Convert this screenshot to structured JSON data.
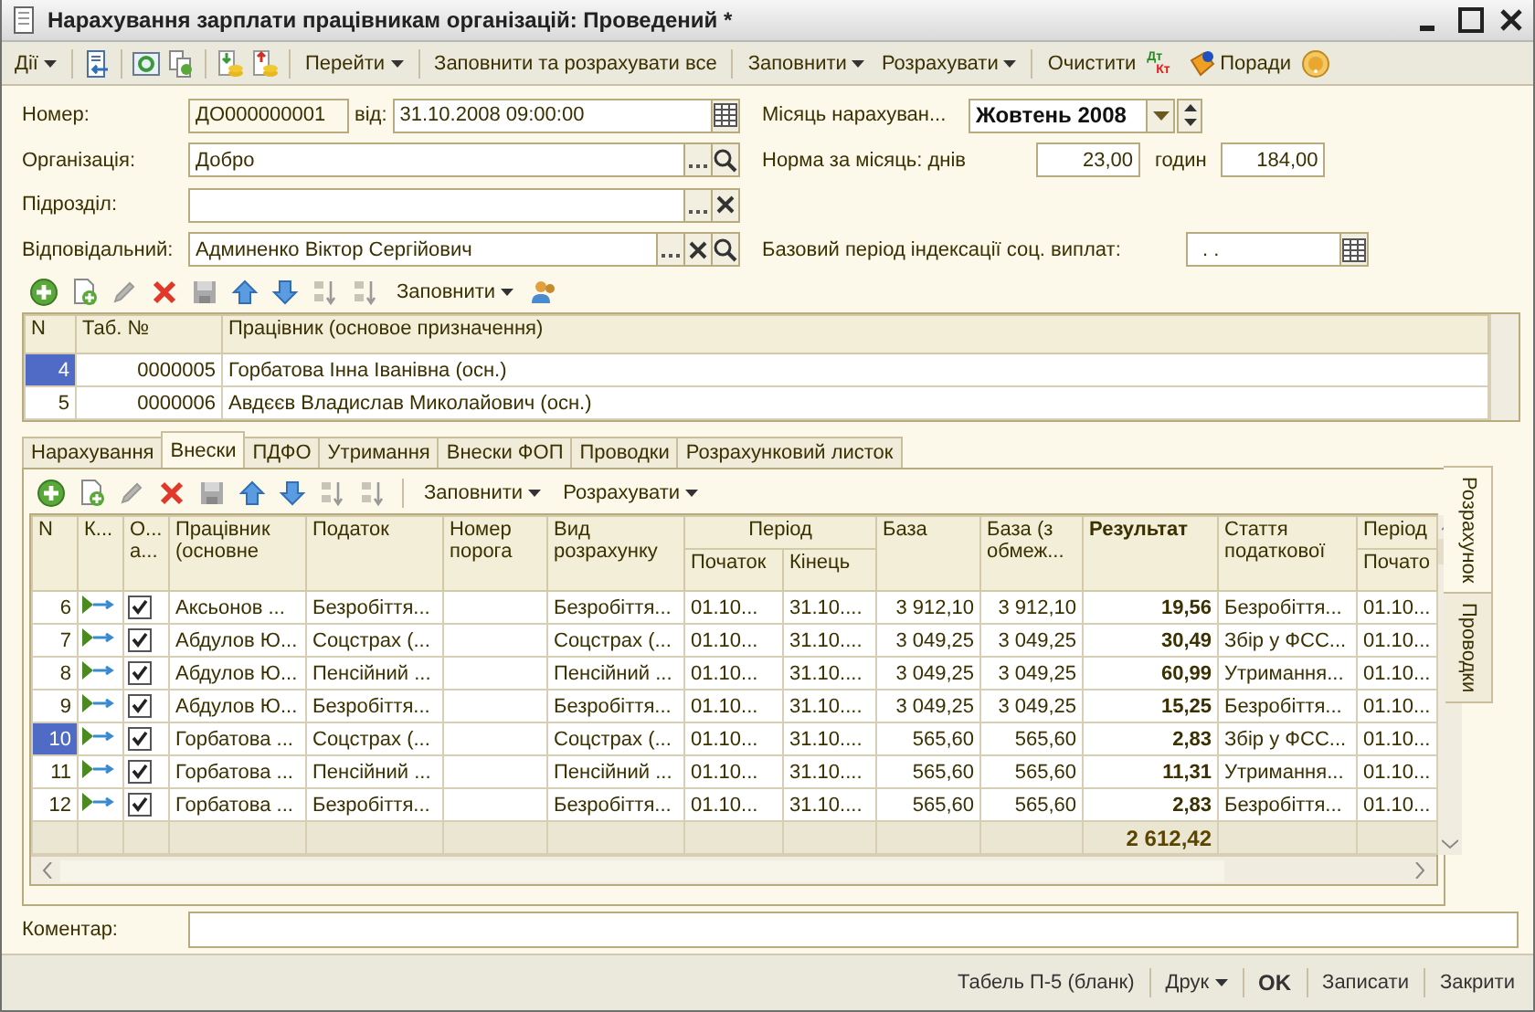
{
  "window": {
    "title": "Нарахування зарплати працівникам організацій: Проведений *"
  },
  "toolbar": {
    "actions": "Дії",
    "go_to": "Перейти",
    "fill_calc_all": "Заповнити та розрахувати все",
    "fill": "Заповнити",
    "calculate": "Розрахувати",
    "clear": "Очистити",
    "debit_credit": [
      "Дт",
      "Кт"
    ],
    "tips": "Поради"
  },
  "form": {
    "number_label": "Номер:",
    "number": "ДО000000001",
    "date_label": "від:",
    "date": "31.10.2008 09:00:00",
    "org_label": "Організація:",
    "org": "Добро",
    "dept_label": "Підрозділ:",
    "responsible_label": "Відповідальний:",
    "responsible": "Админенко Віктор Сергійович",
    "month_label": "Місяць нарахуван...",
    "month": "Жовтень 2008",
    "norm_label": "Норма за місяць: днів",
    "norm_days": "23,00",
    "hours_label": "годин",
    "norm_hours": "184,00",
    "base_period_label": "Базовий період індексації соц. виплат:",
    "base_period": ". ."
  },
  "employees": {
    "fill": "Заповнити",
    "columns": [
      "N",
      "Таб. №",
      "Працівник (основое призначення)"
    ],
    "rows": [
      {
        "n": "4",
        "tab": "0000005",
        "name": "Горбатова Інна Іванівна (осн.)",
        "selected": true
      },
      {
        "n": "5",
        "tab": "0000006",
        "name": "Авдєєв Владислав Миколайович (осн.)",
        "selected": false
      }
    ]
  },
  "tabs": [
    {
      "label": "Нарахування",
      "selected": false
    },
    {
      "label": "Внески",
      "selected": true
    },
    {
      "label": "ПДФО",
      "selected": false
    },
    {
      "label": "Утримання",
      "selected": false
    },
    {
      "label": "Внески ФОП",
      "selected": false
    },
    {
      "label": "Проводки",
      "selected": false
    },
    {
      "label": "Розрахунковий листок",
      "selected": false
    }
  ],
  "contributions": {
    "fill": "Заповнити",
    "calculate": "Розрахувати",
    "columns": [
      "N",
      "К...",
      "О... а...",
      "Працівник (основне",
      "Податок",
      "Номер порога",
      "Вид розрахунку",
      "Період",
      "База",
      "База (з обмеж...",
      "Результат",
      "Стаття податкової",
      "Період",
      "Початок",
      "Кінець",
      "Почато"
    ],
    "rows": [
      {
        "n": "6",
        "checked": true,
        "selected": false,
        "employee": "Аксьонов ...",
        "tax": "Безробіття...",
        "calc_type": "Безробіття...",
        "start": "01.10...",
        "end": "31.10....",
        "base": "3 912,10",
        "base_limited": "3 912,10",
        "result": "19,56",
        "article": "Безробіття...",
        "period_start": "01.10..."
      },
      {
        "n": "7",
        "checked": true,
        "selected": false,
        "employee": "Абдулов Ю...",
        "tax": "Соцстрах (...",
        "calc_type": "Соцстрах (...",
        "start": "01.10...",
        "end": "31.10....",
        "base": "3 049,25",
        "base_limited": "3 049,25",
        "result": "30,49",
        "article": "Збір у ФСС...",
        "period_start": "01.10..."
      },
      {
        "n": "8",
        "checked": true,
        "selected": false,
        "employee": "Абдулов Ю...",
        "tax": "Пенсійний ...",
        "calc_type": "Пенсійний ...",
        "start": "01.10...",
        "end": "31.10....",
        "base": "3 049,25",
        "base_limited": "3 049,25",
        "result": "60,99",
        "article": "Утримання...",
        "period_start": "01.10..."
      },
      {
        "n": "9",
        "checked": true,
        "selected": false,
        "employee": "Абдулов Ю...",
        "tax": "Безробіття...",
        "calc_type": "Безробіття...",
        "start": "01.10...",
        "end": "31.10....",
        "base": "3 049,25",
        "base_limited": "3 049,25",
        "result": "15,25",
        "article": "Безробіття...",
        "period_start": "01.10..."
      },
      {
        "n": "10",
        "checked": true,
        "selected": true,
        "employee": "Горбатова ...",
        "tax": "Соцстрах (...",
        "calc_type": "Соцстрах (...",
        "start": "01.10...",
        "end": "31.10....",
        "base": "565,60",
        "base_limited": "565,60",
        "result": "2,83",
        "article": "Збір у ФСС...",
        "period_start": "01.10..."
      },
      {
        "n": "11",
        "checked": true,
        "selected": false,
        "employee": "Горбатова ...",
        "tax": "Пенсійний ...",
        "calc_type": "Пенсійний ...",
        "start": "01.10...",
        "end": "31.10....",
        "base": "565,60",
        "base_limited": "565,60",
        "result": "11,31",
        "article": "Утримання...",
        "period_start": "01.10..."
      },
      {
        "n": "12",
        "checked": true,
        "selected": false,
        "employee": "Горбатова ...",
        "tax": "Безробіття...",
        "calc_type": "Безробіття...",
        "start": "01.10...",
        "end": "31.10....",
        "base": "565,60",
        "base_limited": "565,60",
        "result": "2,83",
        "article": "Безробіття...",
        "period_start": "01.10..."
      }
    ],
    "total": "2 612,42"
  },
  "side_tabs": [
    {
      "label": "Розрахунок",
      "selected": true
    },
    {
      "label": "Проводки",
      "selected": false
    }
  ],
  "comment": {
    "label": "Коментар:"
  },
  "buttons": [
    {
      "label": "Табель П-5 (бланк)",
      "dropdown": false,
      "default": false
    },
    {
      "label": "Друк",
      "dropdown": true,
      "default": false
    },
    {
      "label": "OK",
      "dropdown": false,
      "default": true
    },
    {
      "label": "Записати",
      "dropdown": false,
      "default": false
    },
    {
      "label": "Закрити",
      "dropdown": false,
      "default": false
    }
  ]
}
